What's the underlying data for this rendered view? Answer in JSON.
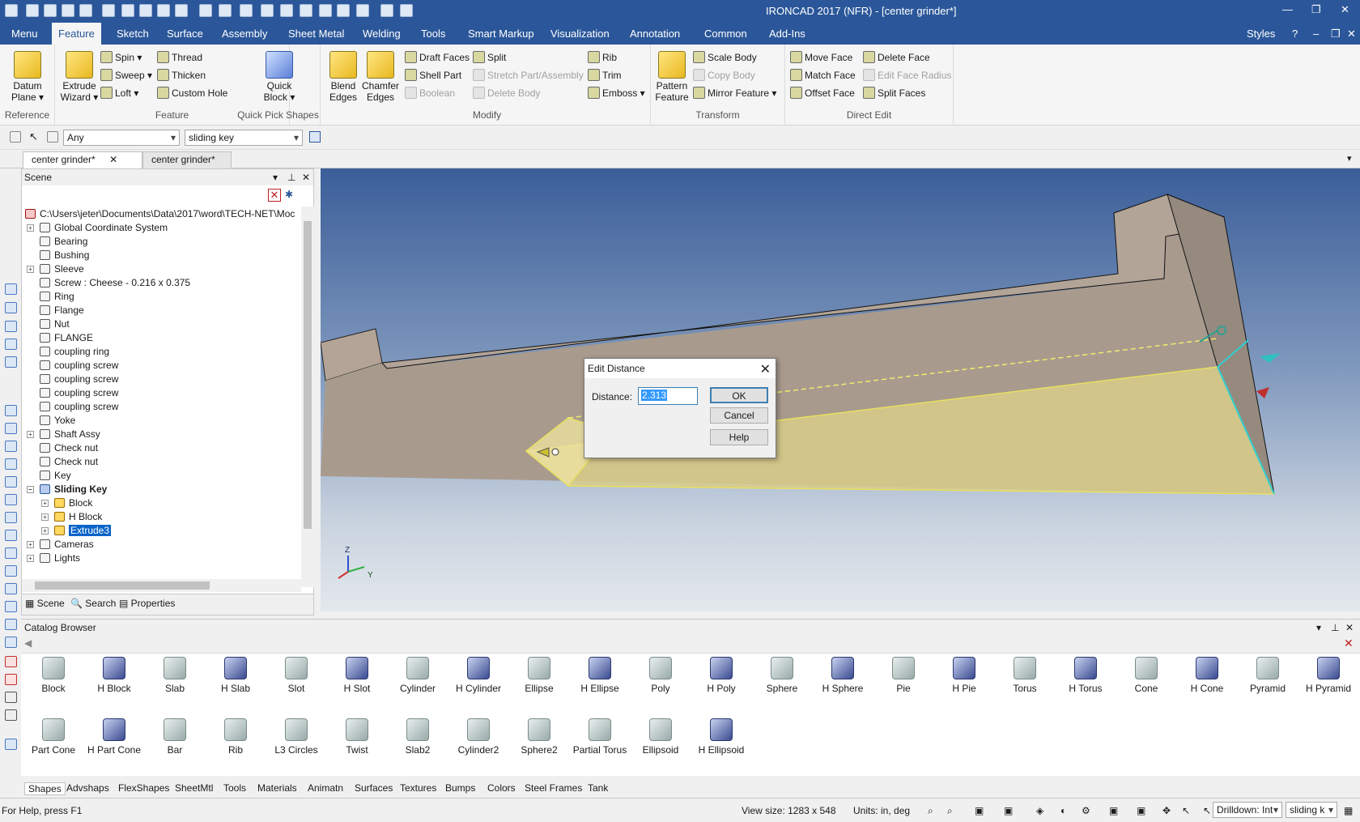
{
  "app": {
    "title": "IRONCAD 2017 (NFR) - [center grinder*]"
  },
  "menu_tabs": [
    "Menu",
    "Feature",
    "Sketch",
    "Surface",
    "Assembly",
    "Sheet Metal",
    "Welding",
    "Tools",
    "Smart Markup",
    "Visualization",
    "Annotation",
    "Common",
    "Add-Ins"
  ],
  "styles_label": "Styles",
  "ribbon": {
    "groups": {
      "reference": "Reference",
      "feature": "Feature",
      "quick": "Quick Pick Shapes",
      "modify": "Modify",
      "transform": "Transform",
      "direct": "Direct Edit"
    },
    "datum_plane": "Datum\nPlane ▾",
    "extrude_wizard": "Extrude\nWizard ▾",
    "spin": "Spin",
    "sweep": "Sweep",
    "loft": "Loft",
    "thread": "Thread",
    "thicken": "Thicken",
    "custom_hole": "Custom Hole",
    "quick_block": "Quick\nBlock ▾",
    "blend_edges": "Blend\nEdges",
    "chamfer_edges": "Chamfer\nEdges",
    "draft_faces": "Draft Faces",
    "shell_part": "Shell Part",
    "boolean": "Boolean",
    "split": "Split",
    "stretch": "Stretch Part/Assembly",
    "delete_body": "Delete Body",
    "rib": "Rib",
    "trim": "Trim",
    "emboss": "Emboss ▾",
    "pattern_feature": "Pattern\nFeature",
    "scale_body": "Scale Body",
    "copy_body": "Copy Body",
    "mirror_feature": "Mirror Feature ▾",
    "move_face": "Move Face",
    "match_face": "Match Face",
    "offset_face": "Offset Face",
    "delete_face": "Delete Face",
    "edit_face_radius": "Edit Face Radius",
    "split_faces": "Split Faces"
  },
  "selbar": {
    "filter": "Any",
    "object": "sliding key"
  },
  "doc_tabs": [
    "center grinder*",
    "center grinder*"
  ],
  "scene": {
    "title": "Scene",
    "root": "C:\\Users\\jeter\\Documents\\Data\\2017\\word\\TECH-NET\\Moc",
    "items": [
      "Global Coordinate System",
      "Bearing",
      "Bushing",
      "Sleeve",
      "Screw : Cheese - 0.216 x 0.375",
      "Ring",
      "Flange",
      "Nut",
      "FLANGE",
      "coupling ring",
      "coupling screw",
      "coupling screw",
      "coupling screw",
      "coupling screw",
      "Yoke",
      "Shaft Assy",
      "Check nut",
      "Check nut",
      "Key",
      "Sliding Key",
      "Block",
      "H Block",
      "Extrude3",
      "Cameras",
      "Lights"
    ],
    "tabs": [
      "Scene",
      "Search",
      "Properties"
    ]
  },
  "dialog": {
    "title": "Edit Distance",
    "label": "Distance:",
    "value": "2.313",
    "ok": "OK",
    "cancel": "Cancel",
    "help": "Help"
  },
  "axis": {
    "z": "Z",
    "y": "Y"
  },
  "catalog": {
    "title": "Catalog Browser",
    "row1": [
      "Block",
      "H Block",
      "Slab",
      "H Slab",
      "Slot",
      "H Slot",
      "Cylinder",
      "H Cylinder",
      "Ellipse",
      "H Ellipse",
      "Poly",
      "H Poly",
      "Sphere",
      "H Sphere",
      "Pie",
      "H Pie",
      "Torus",
      "H Torus",
      "Cone",
      "H Cone",
      "Pyramid",
      "H Pyramid"
    ],
    "row2": [
      "Part Cone",
      "H Part Cone",
      "Bar",
      "Rib",
      "L3 Circles",
      "Twist",
      "Slab2",
      "Cylinder2",
      "Sphere2",
      "Partial Torus",
      "Ellipsoid",
      "H Ellipsoid"
    ],
    "tabs": [
      "Shapes",
      "Advshaps",
      "FlexShapes",
      "SheetMtl",
      "Tools",
      "Materials",
      "Animatn",
      "Surfaces",
      "Textures",
      "Bumps",
      "Colors",
      "Steel Frames",
      "Tank"
    ]
  },
  "status": {
    "help": "For Help, press F1",
    "view_size": "View size: 1283 x  548",
    "units": "Units: in, deg",
    "drilldown": "Drilldown: Int",
    "sel": "sliding k"
  },
  "colors": {
    "accent": "#2b579a",
    "solid": "#a89b8e",
    "highlight": "#f0e68c"
  }
}
